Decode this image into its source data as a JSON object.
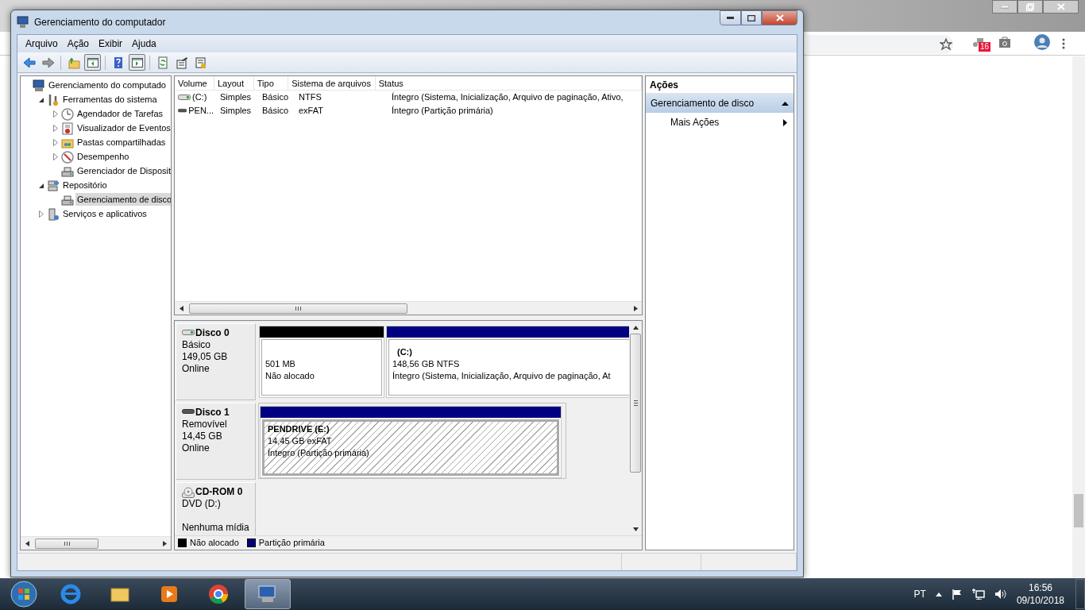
{
  "browser": {
    "extension_badge": "16"
  },
  "window": {
    "title": "Gerenciamento do computador"
  },
  "menu": [
    "Arquivo",
    "Ação",
    "Exibir",
    "Ajuda"
  ],
  "toolbar": [
    {
      "kind": "back",
      "pressed": false
    },
    {
      "kind": "forward",
      "pressed": false
    },
    {
      "kind": "up",
      "pressed": false
    },
    {
      "kind": "tree",
      "pressed": true
    },
    {
      "kind": "help",
      "pressed": false
    },
    {
      "kind": "actions",
      "pressed": true
    },
    {
      "kind": "refresh",
      "pressed": false
    },
    {
      "kind": "properties",
      "pressed": false
    },
    {
      "kind": "export",
      "pressed": false
    }
  ],
  "tree": [
    {
      "label": "Gerenciamento do computado",
      "kind": "computer",
      "selected": false,
      "children": [
        {
          "label": "Ferramentas do sistema",
          "kind": "tools",
          "expanded": true,
          "selected": false,
          "children": [
            {
              "label": "Agendador de Tarefas",
              "kind": "clock",
              "expanded": false,
              "selected": false
            },
            {
              "label": "Visualizador de Eventos",
              "kind": "events",
              "expanded": false,
              "selected": false
            },
            {
              "label": "Pastas compartilhadas",
              "kind": "folder",
              "expanded": false,
              "selected": false
            },
            {
              "label": "Desempenho",
              "kind": "perf",
              "expanded": false,
              "selected": false
            },
            {
              "label": "Gerenciador de Disposit",
              "kind": "device",
              "selected": false
            }
          ]
        },
        {
          "label": "Repositório",
          "kind": "storage",
          "expanded": true,
          "selected": false,
          "children": [
            {
              "label": "Gerenciamento de disco",
              "kind": "device",
              "selected": true
            }
          ]
        },
        {
          "label": "Serviços e aplicativos",
          "kind": "services",
          "expanded": false,
          "selected": false
        }
      ]
    }
  ],
  "volumes": {
    "columns": [
      "Volume",
      "Layout",
      "Tipo",
      "Sistema de arquivos",
      "Status"
    ],
    "rows": [
      {
        "kind": "hdd",
        "cells": [
          "(C:)",
          "Simples",
          "Básico",
          "NTFS",
          "Íntegro (Sistema, Inicialização, Arquivo de paginação, Ativo,"
        ]
      },
      {
        "kind": "removable",
        "cells": [
          "PEN...",
          "Simples",
          "Básico",
          "exFAT",
          "Íntegro (Partição primária)"
        ]
      }
    ]
  },
  "disks": [
    {
      "kind": "hdd",
      "name": "Disco 0",
      "lines": [
        "Básico",
        "149,05 GB",
        "Online"
      ],
      "partitions": [
        {
          "kind": "unallocated",
          "selected": false,
          "lines": [
            "501 MB",
            "Não alocado"
          ]
        },
        {
          "kind": "primary",
          "selected": false,
          "title": "(C:)",
          "lines": [
            "148,56 GB NTFS",
            "Íntegro (Sistema, Inicialização, Arquivo de paginação, At"
          ]
        }
      ]
    },
    {
      "kind": "removable",
      "name": "Disco 1",
      "lines": [
        "Removível",
        "14,45 GB",
        "Online"
      ],
      "partitions": [
        {
          "kind": "primary",
          "selected": true,
          "title": "PENDRIVE  (E:)",
          "lines": [
            "14,45 GB exFAT",
            "Íntegro (Partição primária)"
          ]
        }
      ]
    },
    {
      "kind": "cdrom",
      "name": "CD-ROM 0",
      "lines": [
        "DVD (D:)",
        "Nenhuma mídia"
      ]
    }
  ],
  "legend": [
    {
      "label": "Não alocado",
      "color": "#000000"
    },
    {
      "label": "Partição primária",
      "color": "#000080"
    }
  ],
  "actions": {
    "title": "Ações",
    "items": [
      {
        "kind": "section",
        "label": "Gerenciamento de disco"
      },
      {
        "kind": "item",
        "label": "Mais Ações"
      }
    ]
  },
  "taskbar": {
    "apps": [
      {
        "kind": "ie",
        "selected": false
      },
      {
        "kind": "explorer",
        "selected": false
      },
      {
        "kind": "media",
        "selected": false
      },
      {
        "kind": "chrome",
        "selected": false
      },
      {
        "kind": "mmc",
        "selected": true
      }
    ],
    "language": "PT",
    "time": "16:56",
    "date": "09/10/2018"
  }
}
